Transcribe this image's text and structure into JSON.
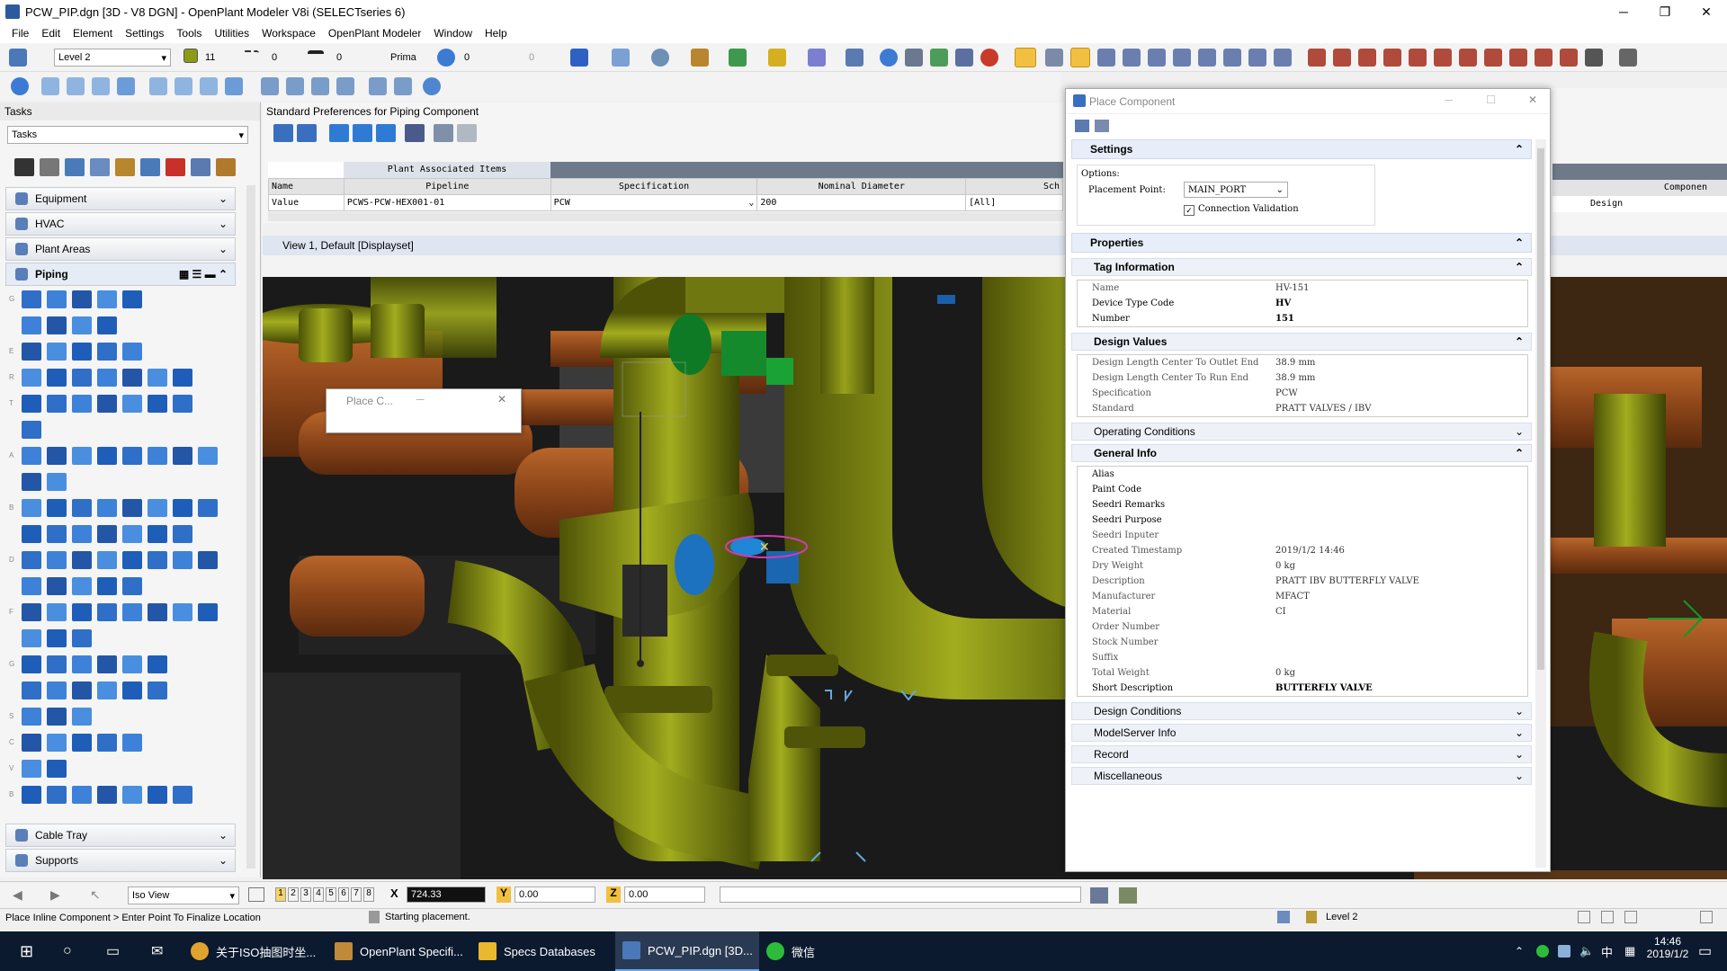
{
  "app": {
    "title": "PCW_PIP.dgn [3D - V8 DGN] - OpenPlant Modeler V8i (SELECTseries 6)",
    "win_min": "─",
    "win_max": "❐",
    "win_close": "✕"
  },
  "menu": [
    "File",
    "Edit",
    "Element",
    "Settings",
    "Tools",
    "Utilities",
    "Workspace",
    "OpenPlant Modeler",
    "Window",
    "Help"
  ],
  "toolbar": {
    "level": "Level 2",
    "color_num": "11",
    "style_num": "0",
    "weight_num": "0",
    "prima": "Prima",
    "n1": "0",
    "n2": "0"
  },
  "tasks": {
    "title": "Tasks",
    "dropdown": "Tasks",
    "categories": [
      "Equipment",
      "HVAC",
      "Plant Areas"
    ],
    "piping": "Piping",
    "bottom": [
      "Cable Tray",
      "Supports"
    ],
    "row_letters": [
      "G",
      "",
      "E",
      "R",
      "T",
      "",
      "A",
      "",
      "B",
      "",
      "D",
      "",
      "F",
      "",
      "G",
      "",
      "S",
      "C",
      "V",
      "B"
    ]
  },
  "prefs": {
    "title": "Standard Preferences for Piping Component",
    "group": "Plant Associated Items",
    "headers": [
      "Name",
      "Pipeline",
      "Specification",
      "Nominal Diameter",
      "Sch"
    ],
    "row_label": "Value",
    "pipeline": "PCWS-PCW-HEX001-01",
    "spec": "PCW",
    "nd": "200",
    "sch": "[All]",
    "right_header": "Componen",
    "right_value": "Design"
  },
  "view": {
    "title": "View 1, Default [Displayset]"
  },
  "float_dialog": {
    "title": "Place C..."
  },
  "place": {
    "title": "Place Component",
    "settings": "Settings",
    "options_label": "Options:",
    "placement_label": "Placement Point:",
    "placement_value": "MAIN_PORT",
    "conn_validation": "Connection Validation",
    "properties": "Properties",
    "tag_info": "Tag Information",
    "tag_rows": [
      {
        "k": "Name",
        "v": "HV-151"
      },
      {
        "k": "Device Type Code",
        "v": "HV"
      },
      {
        "k": "Number",
        "v": "151"
      }
    ],
    "design_values": "Design Values",
    "dv_rows": [
      {
        "k": "Design Length Center To Outlet End",
        "v": "38.9 mm"
      },
      {
        "k": "Design Length Center To Run End",
        "v": "38.9 mm"
      },
      {
        "k": "Specification",
        "v": "PCW"
      },
      {
        "k": "Standard",
        "v": "PRATT VALVES / IBV"
      }
    ],
    "operating": "Operating Conditions",
    "general_info": "General Info",
    "gi_rows": [
      {
        "k": "Alias",
        "v": ""
      },
      {
        "k": "Paint Code",
        "v": ""
      },
      {
        "k": "Seedri Remarks",
        "v": ""
      },
      {
        "k": "Seedri Purpose",
        "v": ""
      },
      {
        "k": "Seedri Inputer",
        "v": ""
      },
      {
        "k": "Created Timestamp",
        "v": "2019/1/2 14:46"
      },
      {
        "k": "Dry Weight",
        "v": "0 kg"
      },
      {
        "k": "Description",
        "v": "PRATT IBV BUTTERFLY VALVE"
      },
      {
        "k": "Manufacturer",
        "v": "MFACT"
      },
      {
        "k": "Material",
        "v": "CI"
      },
      {
        "k": "Order Number",
        "v": ""
      },
      {
        "k": "Stock Number",
        "v": ""
      },
      {
        "k": "Suffix",
        "v": ""
      },
      {
        "k": "Total Weight",
        "v": "0 kg"
      },
      {
        "k": "Short Description",
        "v": "BUTTERFLY VALVE"
      }
    ],
    "collapsed": [
      "Design Conditions",
      "ModelServer Info",
      "Record",
      "Miscellaneous"
    ]
  },
  "status": {
    "iso": "Iso View",
    "views": [
      "1",
      "2",
      "3",
      "4",
      "5",
      "6",
      "7",
      "8"
    ],
    "x_label": "X",
    "x": "724.33",
    "y_label": "Y",
    "y": "0.00",
    "z_label": "Z",
    "z": "0.00",
    "prompt": "Place Inline Component > Enter Point To Finalize Location",
    "message": "Starting placement.",
    "level": "Level 2"
  },
  "taskbar": {
    "items": [
      "关于ISO抽图时坐...",
      "OpenPlant Specifi...",
      "Specs Databases",
      "PCW_PIP.dgn [3D...",
      "微信"
    ],
    "time": "14:46",
    "date": "2019/1/2",
    "ime": "中"
  },
  "colors": {
    "pipe": "#8a9414",
    "pipe_dark": "#5c6309",
    "equip": "#9a4e1e",
    "accent": "#0078d7"
  }
}
